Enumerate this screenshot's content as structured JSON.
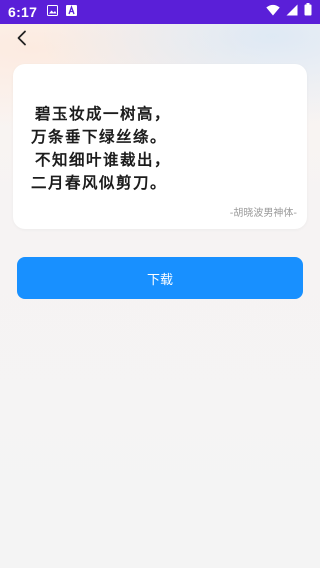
{
  "status_bar": {
    "time": "6:17",
    "background": "#5a1fd8",
    "left_icons": [
      "photo-notification-icon",
      "a-notification-icon"
    ],
    "right_icons": [
      "wifi-icon",
      "cellular-signal-icon",
      "battery-icon"
    ]
  },
  "nav": {
    "back_icon": "chevron-left-icon"
  },
  "preview": {
    "poem_lines": [
      "碧玉妆成一树高，",
      "万条垂下绿丝绦。",
      "不知细叶谁裁出，",
      "二月春风似剪刀。"
    ],
    "font_name": "-胡晓波男神体-"
  },
  "actions": {
    "download_label": "下载",
    "download_color": "#1890ff"
  }
}
